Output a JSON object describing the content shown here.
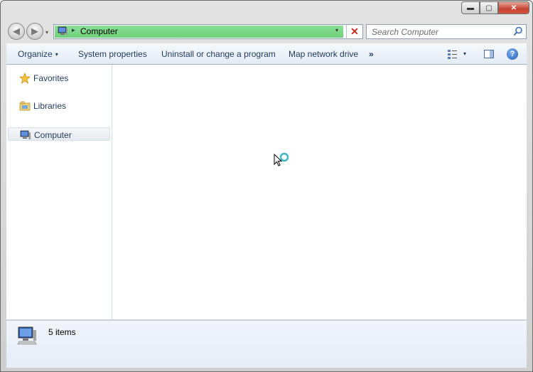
{
  "window": {
    "caption_buttons": {
      "minimize": "▬",
      "maximize": "▢",
      "close": "✕"
    }
  },
  "navbar": {
    "back_glyph": "◀",
    "forward_glyph": "▶",
    "address": {
      "icon": "computer-icon",
      "separator": "▸",
      "path": "Computer",
      "dropdown_glyph": "▾",
      "stop_glyph": "✕",
      "fill_color": "#7bd888"
    },
    "search": {
      "placeholder": "Search Computer",
      "icon": "search-icon"
    }
  },
  "toolbar": {
    "organize": "Organize",
    "system_properties": "System properties",
    "uninstall": "Uninstall or change a program",
    "map_drive": "Map network drive",
    "overflow": "»",
    "dropdown_glyph": "▾",
    "help_glyph": "?"
  },
  "sidebar": {
    "items": [
      {
        "label": "Favorites",
        "icon": "star-icon"
      },
      {
        "label": "Libraries",
        "icon": "library-icon"
      },
      {
        "label": "Computer",
        "icon": "computer-icon",
        "selected": true
      }
    ]
  },
  "details": {
    "count": "5 items",
    "icon": "computer-icon"
  },
  "colors": {
    "accent": "#1e395b",
    "toolbar_bg": "#e8eff7",
    "progress_green": "#7bd888"
  }
}
